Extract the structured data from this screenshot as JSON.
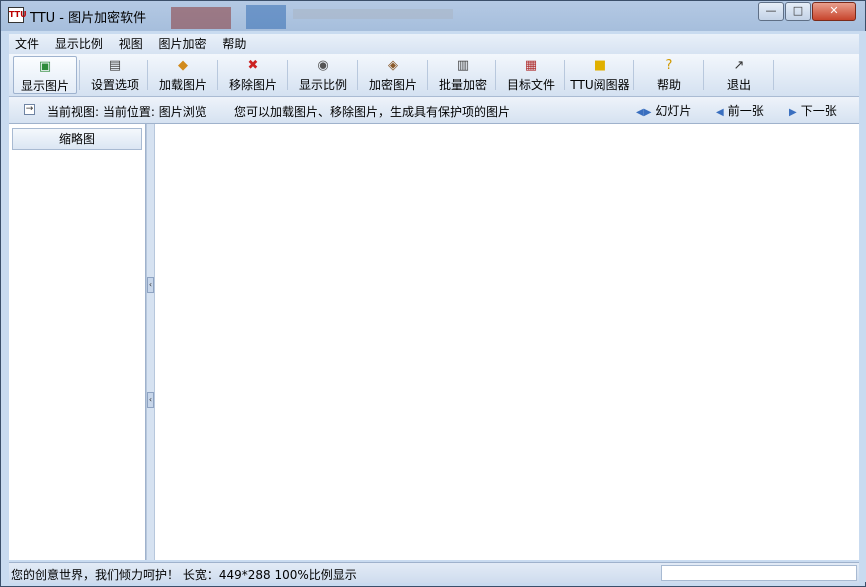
{
  "window": {
    "title": "TTU - 图片加密软件",
    "app_icon_text": "TTU",
    "controls": {
      "minimize": "—",
      "maximize": "□",
      "close": "✕"
    }
  },
  "menu": [
    "文件",
    "显示比例",
    "视图",
    "图片加密",
    "帮助"
  ],
  "toolbar": [
    {
      "label": "显示图片",
      "icon": "image-icon",
      "glyph": "▣",
      "color": "#2e8b3a"
    },
    {
      "label": "设置选项",
      "icon": "settings-icon",
      "glyph": "▤",
      "color": "#444444"
    },
    {
      "label": "加载图片",
      "icon": "load-icon",
      "glyph": "◆",
      "color": "#d18a1c"
    },
    {
      "label": "移除图片",
      "icon": "remove-icon",
      "glyph": "✖",
      "color": "#cc2222"
    },
    {
      "label": "显示比例",
      "icon": "zoom-icon",
      "glyph": "◉",
      "color": "#555555"
    },
    {
      "label": "加密图片",
      "icon": "encrypt-icon",
      "glyph": "◈",
      "color": "#8a5a2a"
    },
    {
      "label": "批量加密",
      "icon": "batch-icon",
      "glyph": "▥",
      "color": "#444444"
    },
    {
      "label": "目标文件",
      "icon": "target-file-icon",
      "glyph": "▦",
      "color": "#b03030"
    },
    {
      "label": "TTU阅图器",
      "icon": "ttu-viewer-icon",
      "glyph": "■",
      "color": "#e0b000"
    },
    {
      "label": "帮助",
      "icon": "help-icon",
      "glyph": "?",
      "color": "#d19a00"
    },
    {
      "label": "退出",
      "icon": "exit-icon",
      "glyph": "↗",
      "color": "#333333"
    }
  ],
  "nav": {
    "expand": "→",
    "current_view": "当前视图: 当前位置: 图片浏览",
    "hint": "您可以加载图片、移除图片，生成具有保护项的图片",
    "slideshow": "幻灯片",
    "prev": "前一张",
    "next": "下一张"
  },
  "left_panel": {
    "header": "缩略图"
  },
  "status": {
    "text": "您的创意世界，我们倾力呵护！  长宽：449*288   100%比例显示"
  }
}
